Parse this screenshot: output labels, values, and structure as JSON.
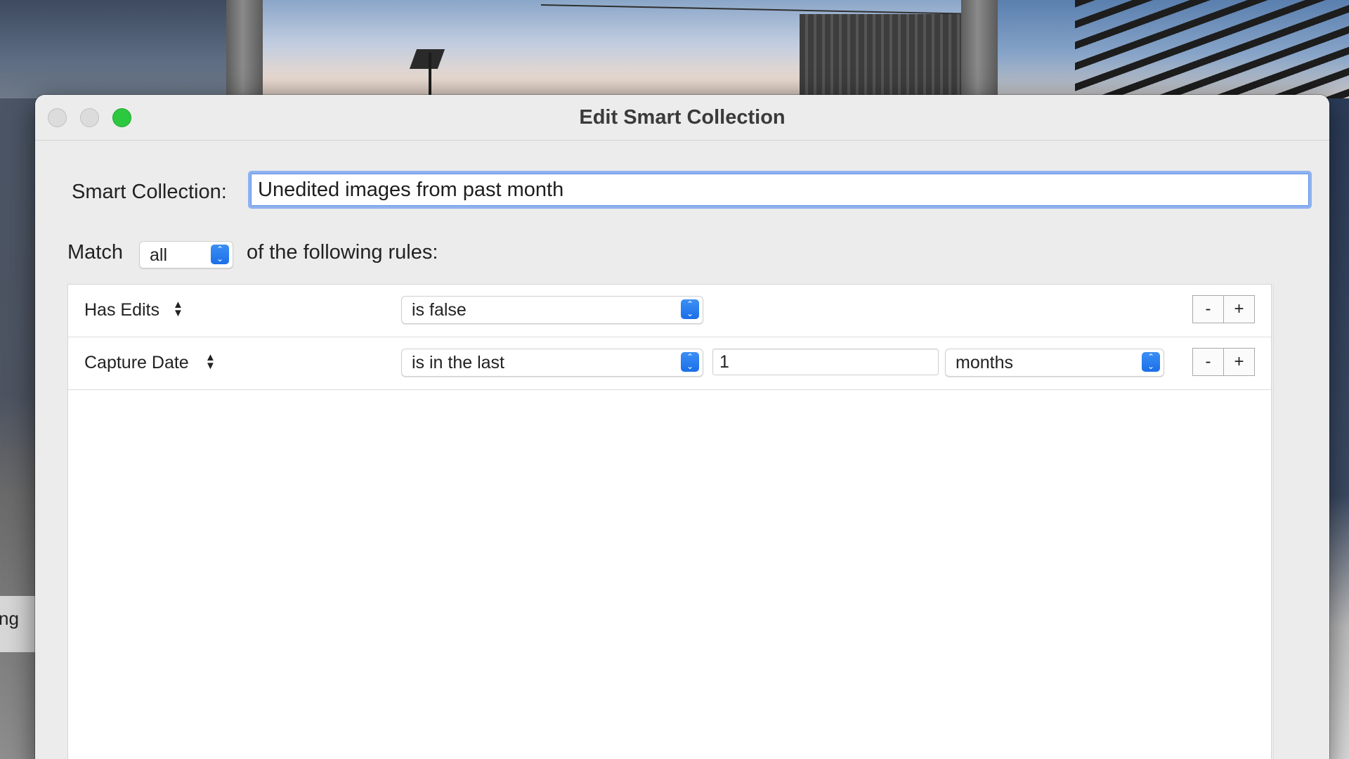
{
  "window": {
    "title": "Edit Smart Collection"
  },
  "background": {
    "left_fragment_text": "ng"
  },
  "name_row": {
    "label": "Smart Collection:",
    "value": "Unedited images from past month"
  },
  "match_row": {
    "prefix": "Match",
    "selected": "all",
    "suffix": "of the following rules:"
  },
  "rules": [
    {
      "field": "Has Edits",
      "operator": "is false",
      "remove_label": "-",
      "add_label": "+"
    },
    {
      "field": "Capture Date",
      "operator": "is in the last",
      "value": "1",
      "unit": "months",
      "remove_label": "-",
      "add_label": "+"
    }
  ],
  "colors": {
    "accent": "#1a6fe8",
    "focus_ring": "#8fb2f0",
    "zoom_button": "#2cc840"
  },
  "icons": {
    "popup_stepper": "chevron-up-down-icon",
    "field_sort": "up-down-arrows-icon"
  }
}
